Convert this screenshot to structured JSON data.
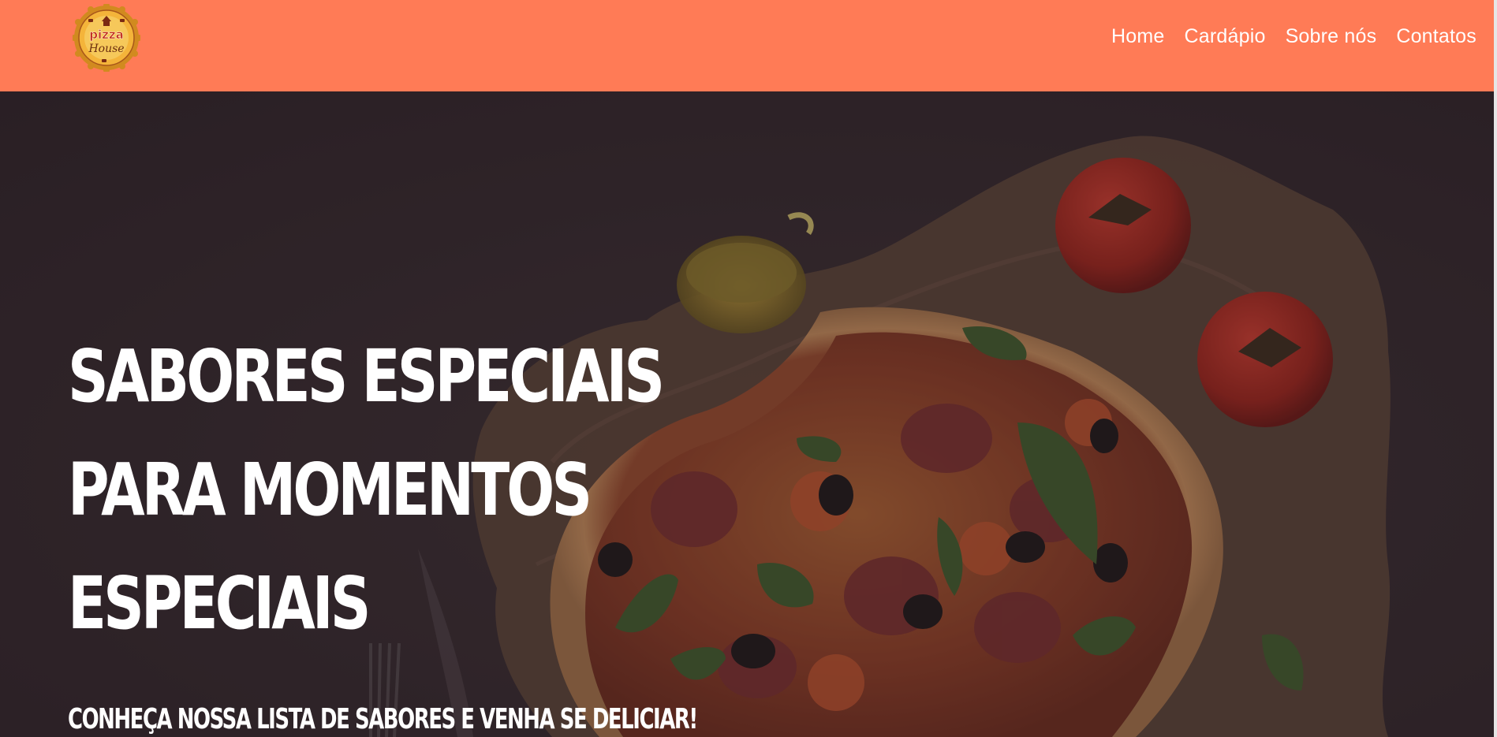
{
  "header": {
    "logo": {
      "text_top": "pizza",
      "text_bottom": "House",
      "icon": "pizza-house-logo"
    },
    "nav": [
      {
        "label": "Home"
      },
      {
        "label": "Cardápio"
      },
      {
        "label": "Sobre nós"
      },
      {
        "label": "Contatos"
      }
    ]
  },
  "hero": {
    "title_lines": [
      "SABORES ESPECIAIS",
      "PARA MOMENTOS",
      "ESPECIAIS"
    ],
    "subtitle": "CONHEÇA NOSSA LISTA DE SABORES E VENHA SE DELICIAR!",
    "image": "pizza-with-tomatoes-and-olive-oil"
  },
  "colors": {
    "header_bg": "#ff7b56",
    "hero_bg": "#2b2126",
    "text": "#ffffff"
  }
}
